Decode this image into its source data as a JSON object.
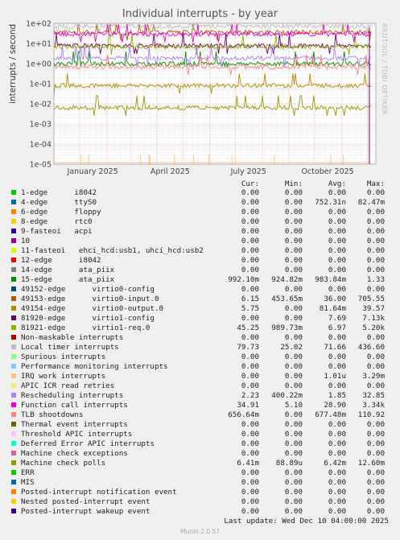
{
  "chart_data": {
    "type": "line",
    "title": "Individual interrupts - by year",
    "ylabel": "interrupts / second",
    "yscale": "log",
    "ylim": [
      1e-05,
      100
    ],
    "y_ticks": [
      "1e+02",
      "1e+01",
      "1e+00",
      "1e-01",
      "1e-02",
      "1e-03",
      "1e-04",
      "1e-05"
    ],
    "x_ticks": [
      "January 2025",
      "April 2025",
      "July 2025",
      "October 2025"
    ],
    "grid": true,
    "legend_columns": [
      "Cur:",
      "Min:",
      "Avg:",
      "Max:"
    ],
    "series": [
      {
        "name": "1-edge      i8042",
        "color": "#00cc00",
        "cur": "0.00",
        "min": "0.00",
        "avg": "0.00",
        "max": "0.00"
      },
      {
        "name": "4-edge      ttyS0",
        "color": "#0066b3",
        "cur": "0.00",
        "min": "0.00",
        "avg": "752.31n",
        "max": "82.47m"
      },
      {
        "name": "6-edge      floppy",
        "color": "#ff8000",
        "cur": "0.00",
        "min": "0.00",
        "avg": "0.00",
        "max": "0.00"
      },
      {
        "name": "8-edge      rtc0",
        "color": "#ffcc00",
        "cur": "0.00",
        "min": "0.00",
        "avg": "0.00",
        "max": "0.00"
      },
      {
        "name": "9-fasteoi   acpi",
        "color": "#330099",
        "cur": "0.00",
        "min": "0.00",
        "avg": "0.00",
        "max": "0.00"
      },
      {
        "name": "10",
        "color": "#990099",
        "cur": "0.00",
        "min": "0.00",
        "avg": "0.00",
        "max": "0.00"
      },
      {
        "name": "11-fasteoi   ehci_hcd:usb1, uhci_hcd:usb2",
        "color": "#ccff00",
        "cur": "0.00",
        "min": "0.00",
        "avg": "0.00",
        "max": "0.00"
      },
      {
        "name": "12-edge      i8042",
        "color": "#ff0000",
        "cur": "0.00",
        "min": "0.00",
        "avg": "0.00",
        "max": "0.00"
      },
      {
        "name": "14-edge      ata_piix",
        "color": "#808080",
        "cur": "0.00",
        "min": "0.00",
        "avg": "0.00",
        "max": "0.00"
      },
      {
        "name": "15-edge      ata_piix",
        "color": "#008f00",
        "cur": "992.10m",
        "min": "924.82m",
        "avg": "983.84m",
        "max": "1.33"
      },
      {
        "name": "49152-edge      virtio0-config",
        "color": "#00487d",
        "cur": "0.00",
        "min": "0.00",
        "avg": "0.00",
        "max": "0.00"
      },
      {
        "name": "49153-edge      virtio0-input.0",
        "color": "#b35a00",
        "cur": "6.15",
        "min": "453.65m",
        "avg": "36.00",
        "max": "705.55"
      },
      {
        "name": "49154-edge      virtio0-output.0",
        "color": "#b38f00",
        "cur": "5.75",
        "min": "0.00",
        "avg": "81.64m",
        "max": "39.57"
      },
      {
        "name": "81920-edge      virtio1-config",
        "color": "#6b006b",
        "cur": "0.00",
        "min": "0.00",
        "avg": "7.69",
        "max": "7.13k"
      },
      {
        "name": "81921-edge      virtio1-req.0",
        "color": "#8fb300",
        "cur": "45.25",
        "min": "989.73m",
        "avg": "6.97",
        "max": "5.20k"
      },
      {
        "name": "Non-maskable interrupts",
        "color": "#b30000",
        "cur": "0.00",
        "min": "0.00",
        "avg": "0.00",
        "max": "0.00"
      },
      {
        "name": "Local timer interrupts",
        "color": "#bebebe",
        "cur": "79.73",
        "min": "25.02",
        "avg": "71.66",
        "max": "436.60"
      },
      {
        "name": "Spurious interrupts",
        "color": "#80ff80",
        "cur": "0.00",
        "min": "0.00",
        "avg": "0.00",
        "max": "0.00"
      },
      {
        "name": "Performance monitoring interrupts",
        "color": "#80c9ff",
        "cur": "0.00",
        "min": "0.00",
        "avg": "0.00",
        "max": "0.00"
      },
      {
        "name": "IRQ work interrupts",
        "color": "#ffc080",
        "cur": "0.00",
        "min": "0.00",
        "avg": "1.01u",
        "max": "3.29m"
      },
      {
        "name": "APIC ICR read retries",
        "color": "#ffe680",
        "cur": "0.00",
        "min": "0.00",
        "avg": "0.00",
        "max": "0.00"
      },
      {
        "name": "Rescheduling interrupts",
        "color": "#aa80ff",
        "cur": "2.23",
        "min": "400.22m",
        "avg": "1.85",
        "max": "32.85"
      },
      {
        "name": "Function call interrupts",
        "color": "#ee00cc",
        "cur": "34.91",
        "min": "5.10",
        "avg": "28.90",
        "max": "3.34k"
      },
      {
        "name": "TLB shootdowns",
        "color": "#ff8080",
        "cur": "656.64m",
        "min": "0.00",
        "avg": "677.48m",
        "max": "110.92"
      },
      {
        "name": "Thermal event interrupts",
        "color": "#666600",
        "cur": "0.00",
        "min": "0.00",
        "avg": "0.00",
        "max": "0.00"
      },
      {
        "name": "Threshold APIC interrupts",
        "color": "#ffbfff",
        "cur": "0.00",
        "min": "0.00",
        "avg": "0.00",
        "max": "0.00"
      },
      {
        "name": "Deferred Error APIC interrupts",
        "color": "#00ffcc",
        "cur": "0.00",
        "min": "0.00",
        "avg": "0.00",
        "max": "0.00"
      },
      {
        "name": "Machine check exceptions",
        "color": "#cc6699",
        "cur": "0.00",
        "min": "0.00",
        "avg": "0.00",
        "max": "0.00"
      },
      {
        "name": "Machine check polls",
        "color": "#999900",
        "cur": "6.41m",
        "min": "88.89u",
        "avg": "6.42m",
        "max": "12.60m"
      },
      {
        "name": "ERR",
        "color": "#00cc00",
        "cur": "0.00",
        "min": "0.00",
        "avg": "0.00",
        "max": "0.00"
      },
      {
        "name": "MIS",
        "color": "#0066b3",
        "cur": "0.00",
        "min": "0.00",
        "avg": "0.00",
        "max": "0.00"
      },
      {
        "name": "Posted-interrupt notification event",
        "color": "#ff8000",
        "cur": "0.00",
        "min": "0.00",
        "avg": "0.00",
        "max": "0.00"
      },
      {
        "name": "Nested posted-interrupt event",
        "color": "#ffcc00",
        "cur": "0.00",
        "min": "0.00",
        "avg": "0.00",
        "max": "0.00"
      },
      {
        "name": "Posted-interrupt wakeup event",
        "color": "#330099",
        "cur": "0.00",
        "min": "0.00",
        "avg": "0.00",
        "max": "0.00"
      }
    ]
  },
  "last_update": "Last update: Wed Dec 10 04:00:00 2025",
  "watermark": "RRDTOOL / TOBI OETIKER",
  "footer": "Munin 2.0.57"
}
